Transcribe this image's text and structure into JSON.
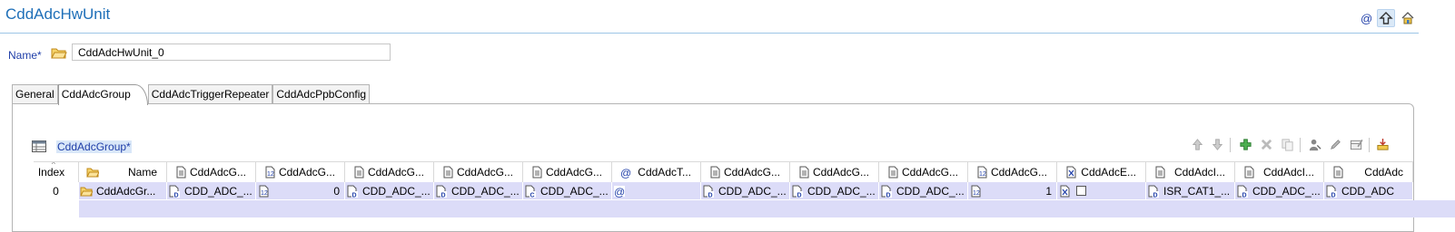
{
  "header": {
    "title": "CddAdcHwUnit",
    "toolbar": [
      {
        "icon": "at-icon"
      },
      {
        "icon": "up-arrow-icon",
        "selected": true
      },
      {
        "icon": "home-icon"
      }
    ]
  },
  "name_field": {
    "label": "Name*",
    "value": "CddAdcHwUnit_0"
  },
  "tabs": [
    {
      "label": "General",
      "active": false
    },
    {
      "label": "CddAdcGroup",
      "active": true
    },
    {
      "label": "CddAdcTriggerRepeater",
      "active": false
    },
    {
      "label": "CddAdcPpbConfig",
      "active": false
    }
  ],
  "section": {
    "title": "CddAdcGroup*",
    "toolbar": [
      "move-up-icon",
      "move-down-icon",
      "add-icon",
      "delete-icon",
      "copy-icon",
      "person-icon",
      "edit-icon",
      "table-edit-icon",
      "import-icon"
    ]
  },
  "table": {
    "columns": [
      {
        "label": "Index",
        "icon": ""
      },
      {
        "label": "Name",
        "icon": "folder-icon"
      },
      {
        "label": "CddAdcG...",
        "icon": "doc-icon"
      },
      {
        "label": "CddAdcG...",
        "icon": "number-doc-icon"
      },
      {
        "label": "CddAdcG...",
        "icon": "doc-icon"
      },
      {
        "label": "CddAdcG...",
        "icon": "doc-icon"
      },
      {
        "label": "CddAdcG...",
        "icon": "doc-icon"
      },
      {
        "label": "CddAdcT...",
        "icon": "at-icon"
      },
      {
        "label": "CddAdcG...",
        "icon": "doc-icon"
      },
      {
        "label": "CddAdcG...",
        "icon": "doc-icon"
      },
      {
        "label": "CddAdcG...",
        "icon": "doc-icon"
      },
      {
        "label": "CddAdcG...",
        "icon": "number-doc-icon"
      },
      {
        "label": "CddAdcE...",
        "icon": "boolean-doc-icon"
      },
      {
        "label": "CddAdcI...",
        "icon": "doc-icon"
      },
      {
        "label": "CddAdcI...",
        "icon": "doc-icon"
      },
      {
        "label": "CddAdc",
        "icon": "doc-icon"
      }
    ],
    "rows": [
      {
        "index": "0",
        "cells": [
          {
            "text": "CddAdcGr...",
            "icon": "folder-icon"
          },
          {
            "text": "CDD_ADC_...",
            "icon": "d-doc-icon"
          },
          {
            "text": "0",
            "icon": "number-doc-icon",
            "numeric": true
          },
          {
            "text": "CDD_ADC_...",
            "icon": "d-doc-icon"
          },
          {
            "text": "CDD_ADC_...",
            "icon": "d-doc-icon"
          },
          {
            "text": "CDD_ADC_...",
            "icon": "c-doc-icon"
          },
          {
            "text": "",
            "icon": "at-icon"
          },
          {
            "text": "CDD_ADC_...",
            "icon": "d-doc-icon"
          },
          {
            "text": "CDD_ADC_...",
            "icon": "d-doc-icon"
          },
          {
            "text": "CDD_ADC_...",
            "icon": "d-doc-icon"
          },
          {
            "text": "1",
            "icon": "number-doc-icon",
            "numeric": true
          },
          {
            "text": "",
            "icon": "boolean-doc-icon",
            "checkbox": true,
            "checked": false
          },
          {
            "text": "ISR_CAT1_...",
            "icon": "d-doc-icon"
          },
          {
            "text": "CDD_ADC_...",
            "icon": "d-doc-icon"
          },
          {
            "text": "CDD_ADC",
            "icon": "d-doc-icon"
          }
        ]
      }
    ]
  },
  "colors": {
    "title": "#1e6fb8",
    "label": "#1f3ea8",
    "row_highlight": "#dcdcf8"
  }
}
